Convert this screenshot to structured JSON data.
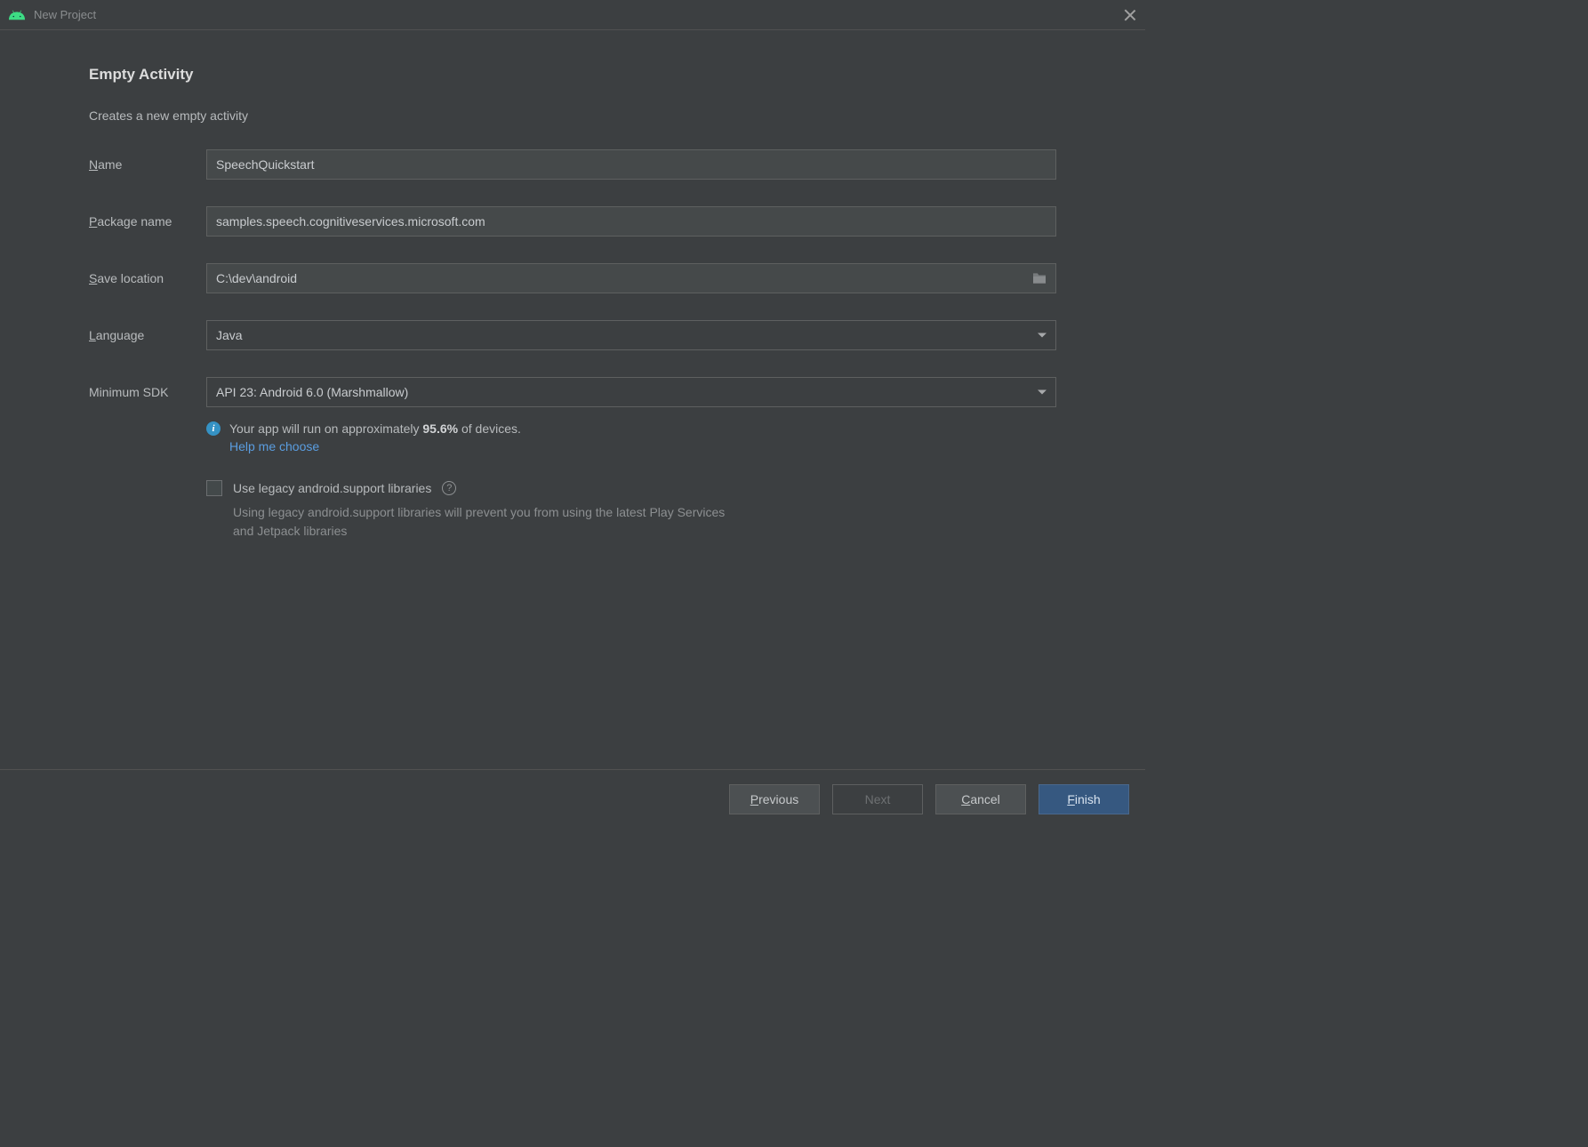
{
  "titlebar": {
    "title": "New Project"
  },
  "page": {
    "heading": "Empty Activity",
    "description": "Creates a new empty activity"
  },
  "fields": {
    "name": {
      "label_first": "N",
      "label_rest": "ame",
      "value": "SpeechQuickstart"
    },
    "package": {
      "label_first": "P",
      "label_rest": "ackage name",
      "value": "samples.speech.cognitiveservices.microsoft.com"
    },
    "save": {
      "label_first": "S",
      "label_rest": "ave location",
      "value": "C:\\dev\\android"
    },
    "language": {
      "label_first": "L",
      "label_rest": "anguage",
      "value": "Java"
    },
    "minsdk": {
      "label": "Minimum SDK",
      "value": "API 23: Android 6.0 (Marshmallow)"
    }
  },
  "info": {
    "prefix": "Your app will run on approximately ",
    "percent": "95.6%",
    "suffix": " of devices.",
    "help": "Help me choose"
  },
  "legacy": {
    "checkbox_label": "Use legacy android.support libraries",
    "note": "Using legacy android.support libraries will prevent you from using the latest Play Services and Jetpack libraries"
  },
  "footer": {
    "previous_first": "P",
    "previous_rest": "revious",
    "next": "Next",
    "cancel_first": "C",
    "cancel_rest": "ancel",
    "finish_first": "F",
    "finish_rest": "inish"
  }
}
